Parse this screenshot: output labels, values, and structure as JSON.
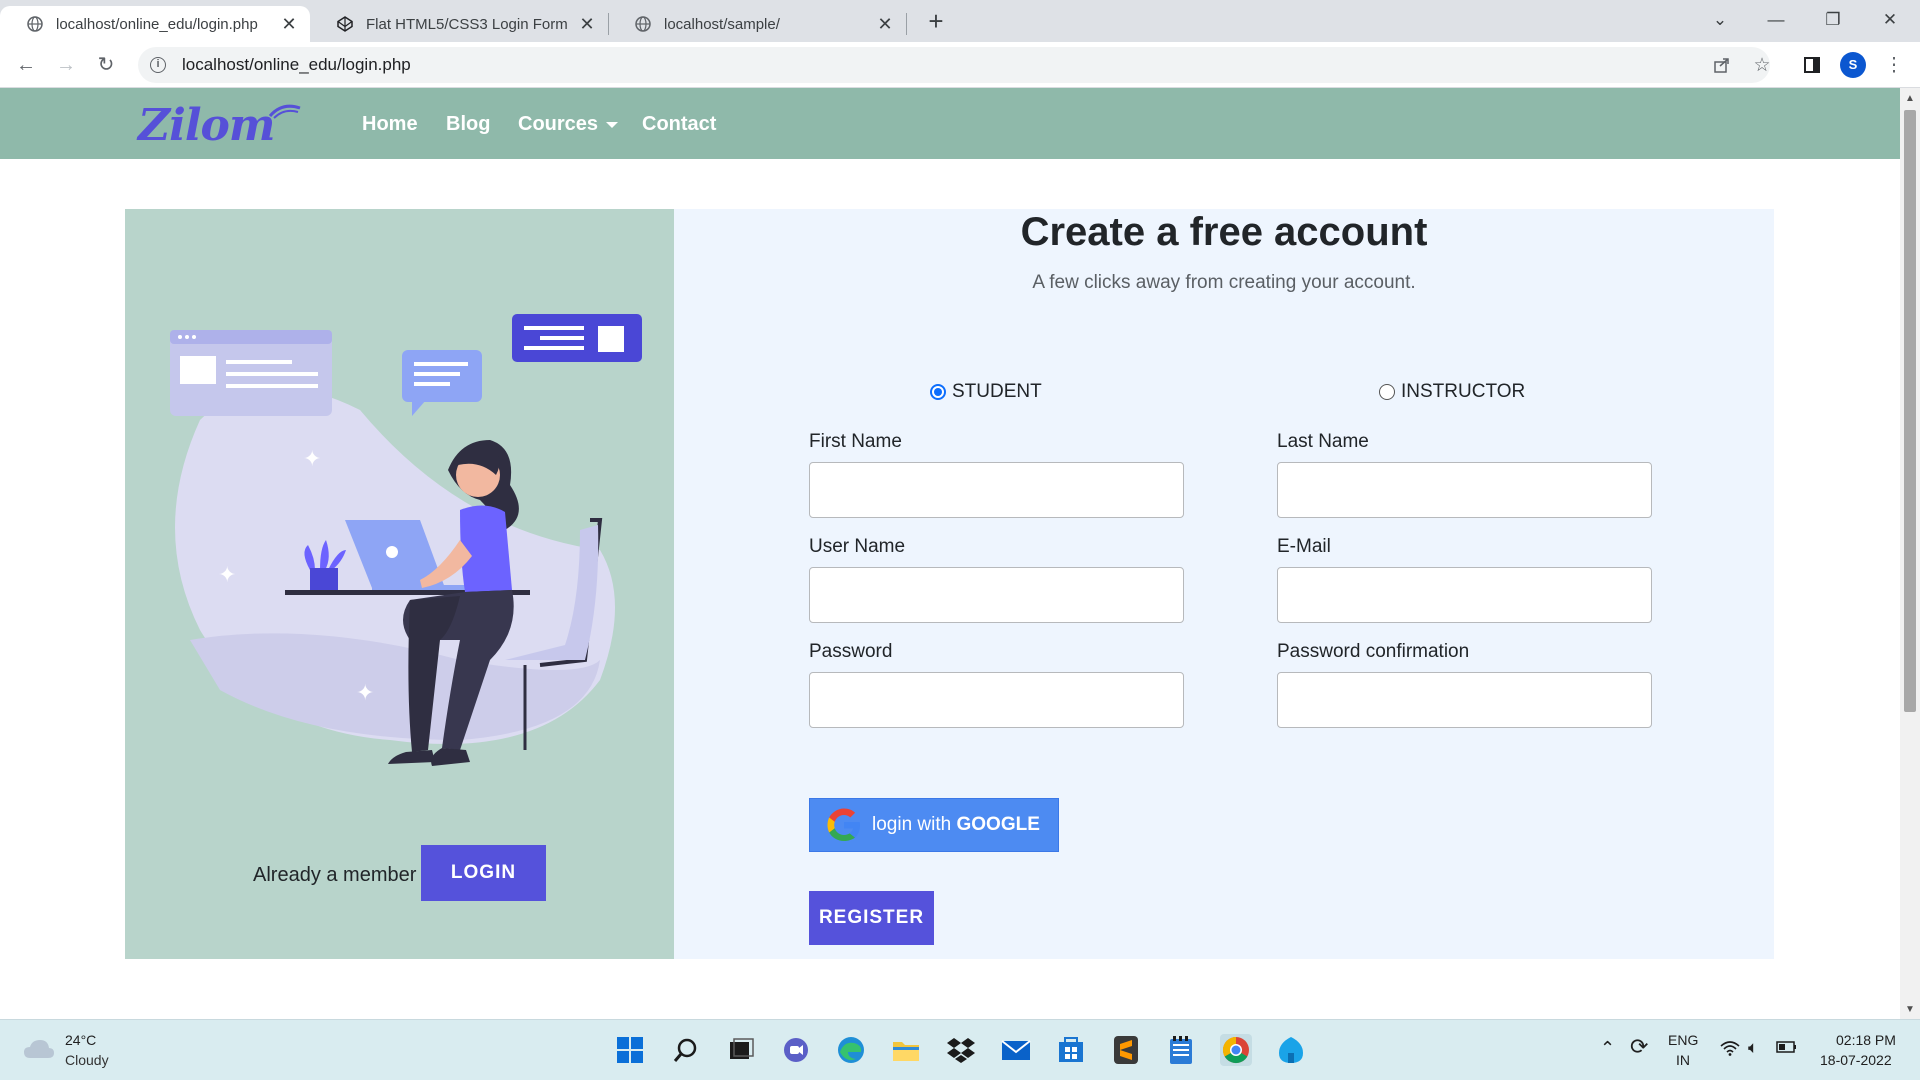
{
  "browser": {
    "tabs": [
      {
        "title": "localhost/online_edu/login.php",
        "active": true
      },
      {
        "title": "Flat HTML5/CSS3 Login Form",
        "active": false
      },
      {
        "title": "localhost/sample/",
        "active": false
      }
    ],
    "url": "localhost/online_edu/login.php",
    "profile_initial": "S"
  },
  "site": {
    "logo_text": "Zilom",
    "nav": {
      "home": "Home",
      "blog": "Blog",
      "cources": "Cources",
      "contact": "Contact"
    }
  },
  "form": {
    "heading": "Create a free account",
    "subheading": "A few clicks away from creating your account.",
    "roles": {
      "student": "STUDENT",
      "instructor": "INSTRUCTOR",
      "selected": "STUDENT"
    },
    "fields": {
      "first_name": {
        "label": "First Name",
        "value": ""
      },
      "last_name": {
        "label": "Last Name",
        "value": ""
      },
      "user_name": {
        "label": "User Name",
        "value": ""
      },
      "email": {
        "label": "E-Mail",
        "value": ""
      },
      "password": {
        "label": "Password",
        "value": ""
      },
      "password_confirmation": {
        "label": "Password confirmation",
        "value": ""
      }
    },
    "google_button": {
      "prefix": "login with ",
      "brand": "GOOGLE"
    },
    "register_button": "REGISTER"
  },
  "side": {
    "already_text": "Already a member",
    "login_button": "LOGIN"
  },
  "colors": {
    "nav_bg": "#8fb9aa",
    "left_panel_bg": "#b8d4cb",
    "right_panel_bg": "#eef5fe",
    "primary_button": "#5552db",
    "google_button": "#4d8bf2"
  },
  "taskbar": {
    "weather_temp": "24°C",
    "weather_condition": "Cloudy",
    "language_line1": "ENG",
    "language_line2": "IN",
    "time": "02:18 PM",
    "date": "18-07-2022"
  }
}
